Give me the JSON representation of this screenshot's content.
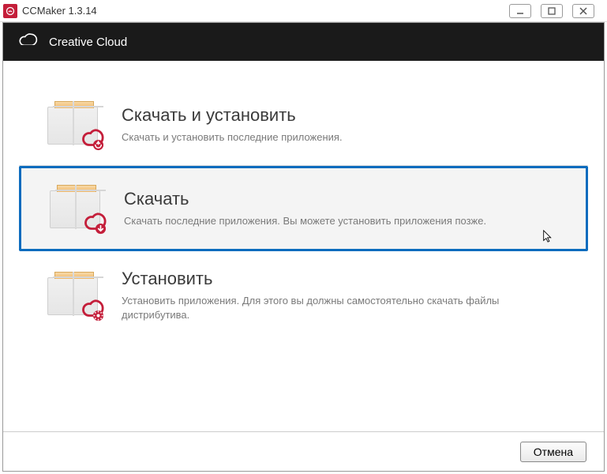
{
  "titlebar": {
    "title": "CCMaker 1.3.14"
  },
  "header": {
    "title": "Creative Cloud"
  },
  "options": [
    {
      "title": "Скачать и установить",
      "desc": "Скачать и установить последние приложения.",
      "selected": false,
      "kind": "download-install"
    },
    {
      "title": "Скачать",
      "desc": "Скачать последние приложения. Вы можете установить приложения позже.",
      "selected": true,
      "kind": "download"
    },
    {
      "title": "Установить",
      "desc": "Установить приложения. Для этого вы должны самостоятельно скачать файлы дистрибутива.",
      "selected": false,
      "kind": "install"
    }
  ],
  "footer": {
    "cancel": "Отмена"
  }
}
